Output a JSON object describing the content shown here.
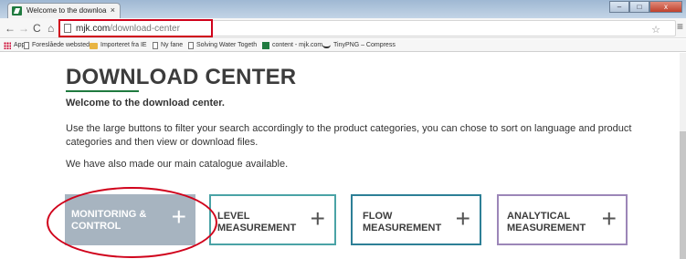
{
  "browser": {
    "tab_title": "Welcome to the downloa",
    "tab_close": "×",
    "window_controls": [
      "–",
      "□",
      "x"
    ],
    "nav": {
      "back": "←",
      "forward": "→",
      "reload": "C",
      "home": "⌂"
    },
    "url_domain": "mjk.com",
    "url_path": "/download-center",
    "star": "☆",
    "menu": "≡",
    "bookmarks": [
      {
        "label": "Apps",
        "icon": "apps-icon"
      },
      {
        "label": "Foreslåede websteder",
        "icon": "page-icon"
      },
      {
        "label": "Importeret fra IE",
        "icon": "folder-icon"
      },
      {
        "label": "Ny fane",
        "icon": "page-icon"
      },
      {
        "label": "Solving Water Togeth",
        "icon": "page-icon"
      },
      {
        "label": "content - mjk.com",
        "icon": "mjk-icon"
      },
      {
        "label": "TinyPNG – Compress",
        "icon": "tinypng-icon"
      }
    ]
  },
  "page": {
    "title": "DOWNLOAD CENTER",
    "welcome": "Welcome to the download center.",
    "intro": "Use the large buttons to filter your search accordingly to the product categories, you can chose to sort on language and product categories and then view or download files.",
    "catalogue": "We have also made our main catalogue available.",
    "categories": [
      {
        "line1": "MONITORING &",
        "line2": "CONTROL",
        "plus": "+"
      },
      {
        "line1": "LEVEL",
        "line2": "MEASUREMENT",
        "plus": "+"
      },
      {
        "line1": "FLOW",
        "line2": "MEASUREMENT",
        "plus": "+"
      },
      {
        "line1": "ANALYTICAL",
        "line2": "MEASUREMENT",
        "plus": "+"
      }
    ]
  },
  "colors": {
    "brand_green": "#1f7a3f",
    "annotation_red": "#d0021b",
    "monitoring_fill": "#a7b4c0",
    "level_border": "#4aa3a6",
    "flow_border": "#2d7f96",
    "analytical_border": "#9c86b8"
  }
}
